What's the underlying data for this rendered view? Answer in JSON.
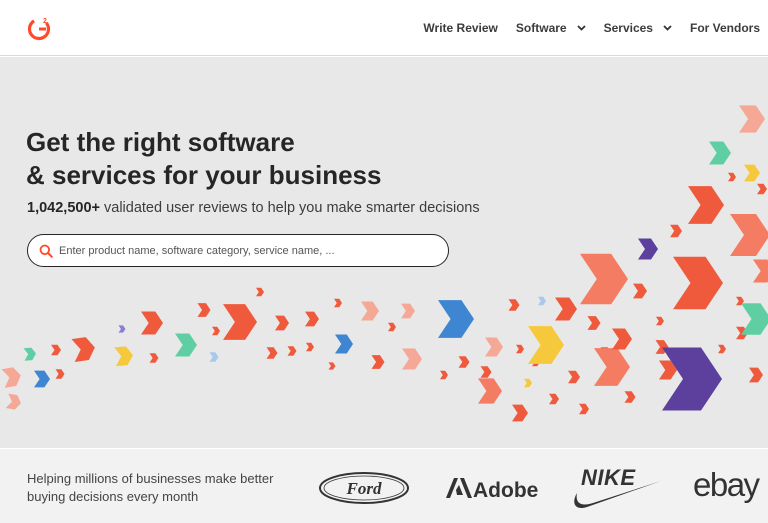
{
  "header": {
    "logo_text": "G2",
    "nav": [
      {
        "label": "Write Review",
        "dropdown": false
      },
      {
        "label": "Software",
        "dropdown": true
      },
      {
        "label": "Services",
        "dropdown": true
      },
      {
        "label": "For Vendors",
        "dropdown": false
      }
    ]
  },
  "hero": {
    "headline_line1": "Get the right software",
    "headline_line2": "& services for your business",
    "reviews_count": "1,042,500+",
    "reviews_text": " validated user reviews to help you make smarter decisions",
    "search_placeholder": "Enter product name, software category, service name, ..."
  },
  "band": {
    "text": "Helping millions of businesses make better buying decisions every month",
    "brands": [
      "Ford",
      "Adobe",
      "NIKE",
      "ebay"
    ]
  },
  "colors": {
    "brand_orange": "#ff492c",
    "background": "#e8e8e8",
    "text": "#262626"
  }
}
